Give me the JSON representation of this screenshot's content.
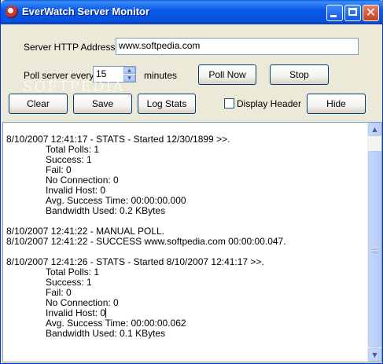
{
  "window": {
    "title": "EverWatch Server Monitor"
  },
  "form": {
    "address_label": "Server HTTP Address",
    "address_value": "www.softpedia.com",
    "poll_label": "Poll server every",
    "poll_value": "15",
    "poll_unit": "minutes",
    "display_header_label": "Display Header",
    "display_header_checked": false
  },
  "buttons": {
    "poll_now": "Poll Now",
    "stop": "Stop",
    "clear": "Clear",
    "save": "Save",
    "log_stats": "Log Stats",
    "hide": "Hide"
  },
  "watermark": "SOFTPEDIA",
  "log": [
    {
      "text": "8/10/2007 12:41:17 - STATS - Started 12/30/1899 >>.",
      "indent": false
    },
    {
      "text": "Total Polls: 1",
      "indent": true
    },
    {
      "text": "Success: 1",
      "indent": true
    },
    {
      "text": "Fail: 0",
      "indent": true
    },
    {
      "text": "No Connection: 0",
      "indent": true
    },
    {
      "text": "Invalid Host: 0",
      "indent": true
    },
    {
      "text": "Avg. Success Time: 00:00:00.000",
      "indent": true
    },
    {
      "text": "Bandwidth Used: 0.2 KBytes",
      "indent": true
    },
    {
      "text": "",
      "indent": false
    },
    {
      "text": "8/10/2007 12:41:22 - MANUAL POLL.",
      "indent": false
    },
    {
      "text": "8/10/2007 12:41:22 - SUCCESS www.softpedia.com 00:00:00.047.",
      "indent": false
    },
    {
      "text": "",
      "indent": false
    },
    {
      "text": "8/10/2007 12:41:26 - STATS - Started 8/10/2007 12:41:17 >>.",
      "indent": false
    },
    {
      "text": "Total Polls: 1",
      "indent": true
    },
    {
      "text": "Success: 1",
      "indent": true
    },
    {
      "text": "Fail: 0",
      "indent": true
    },
    {
      "text": "No Connection: 0",
      "indent": true
    },
    {
      "text": "Invalid Host: 0",
      "indent": true,
      "cursor": true
    },
    {
      "text": "Avg. Success Time: 00:00:00.062",
      "indent": true
    },
    {
      "text": "Bandwidth Used: 0.1 KBytes",
      "indent": true
    }
  ],
  "icons": {
    "app": "app-icon",
    "minimize": "minimize-icon",
    "maximize": "maximize-icon",
    "close": "close-icon",
    "scroll_up": "chevron-up-icon",
    "scroll_down": "chevron-down-icon"
  }
}
